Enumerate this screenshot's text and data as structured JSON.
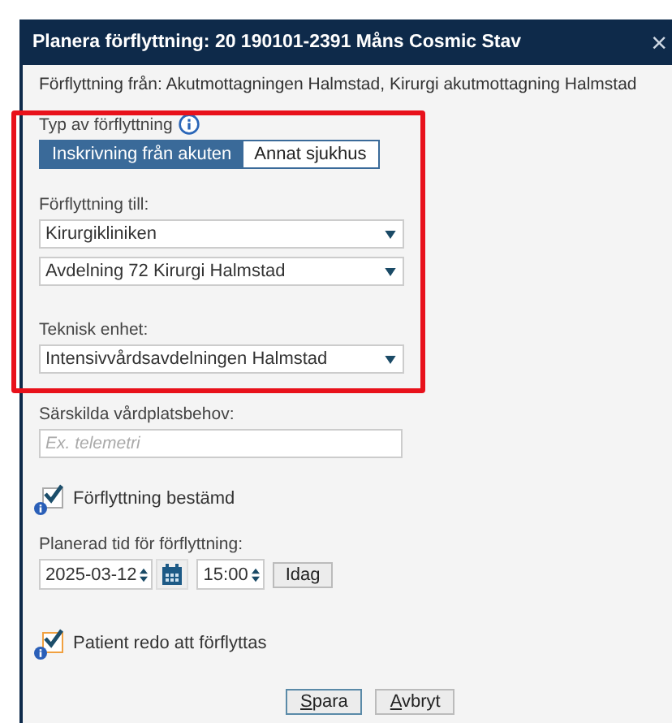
{
  "dialog": {
    "title": "Planera förflyttning: 20 190101-2391 Måns Cosmic Stav",
    "close": "×"
  },
  "from_text": "Förflyttning från: Akutmottagningen Halmstad, Kirurgi akutmottagning Halmstad",
  "type_label": "Typ av förflyttning",
  "type_tabs": [
    {
      "label": "Inskrivning från akuten",
      "selected": true
    },
    {
      "label": "Annat sjukhus",
      "selected": false
    }
  ],
  "to_label": "Förflyttning till:",
  "to_selects": [
    {
      "value": "Kirurgikliniken"
    },
    {
      "value": "Avdelning 72 Kirurgi Halmstad"
    }
  ],
  "unit_label": "Teknisk enhet:",
  "unit_select": {
    "value": "Intensivvårdsavdelningen Halmstad"
  },
  "needs_label": "Särskilda vårdplatsbehov:",
  "needs_field": {
    "placeholder": "Ex. telemetri"
  },
  "decided": {
    "label": "Förflyttning bestämd",
    "checked": true,
    "focused": false
  },
  "time_label": "Planerad tid för förflyttning:",
  "date": "2025-03-12",
  "time": "15:00",
  "today_button": "Idag",
  "ready": {
    "label": "Patient redo att förflyttas",
    "checked": true,
    "focused": true
  },
  "buttons": [
    {
      "label": "Spara",
      "default": true
    },
    {
      "label": "Avbryt",
      "default": false
    }
  ]
}
